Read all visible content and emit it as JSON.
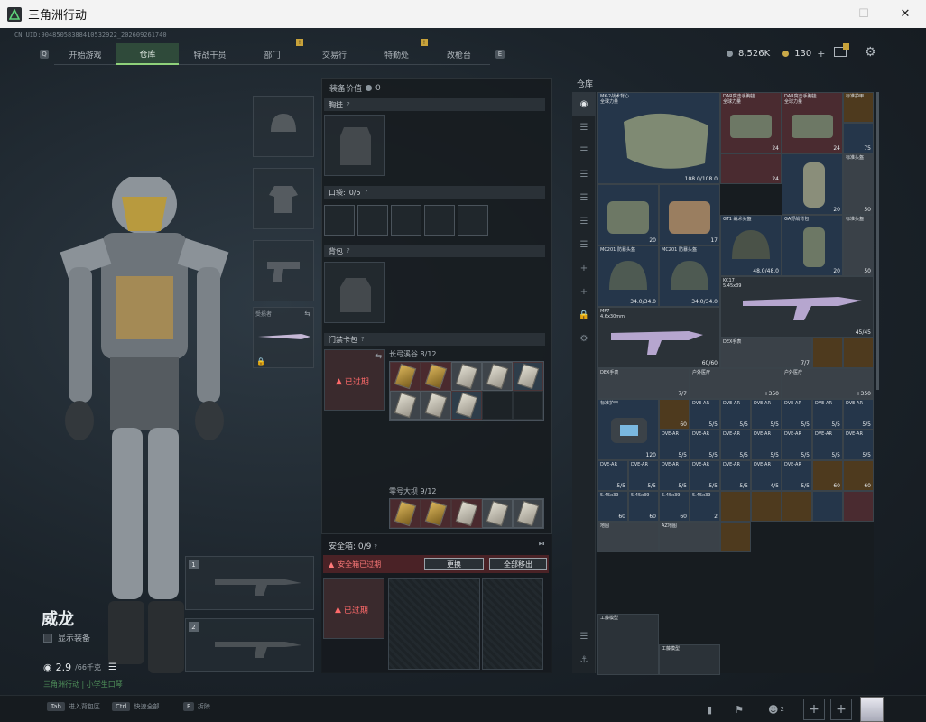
{
  "window": {
    "title": "三角洲行动"
  },
  "uid": "CN UID:9048505838841053292​2_202609261740",
  "nav": {
    "left_key": "Q",
    "right_key": "E",
    "tabs": [
      {
        "label": "开始游戏",
        "active": false,
        "badge": ""
      },
      {
        "label": "仓库",
        "active": true,
        "badge": ""
      },
      {
        "label": "特战干员",
        "active": false,
        "badge": ""
      },
      {
        "label": "部门",
        "active": false,
        "badge": "!"
      },
      {
        "label": "交易行",
        "active": false,
        "badge": ""
      },
      {
        "label": "特勤处",
        "active": false,
        "badge": "!"
      },
      {
        "label": "改枪台",
        "active": false,
        "badge": ""
      }
    ]
  },
  "currency": {
    "silver": "8,526K",
    "gold": "130",
    "plus": "+"
  },
  "operator": {
    "name": "威龙",
    "show_equip": "显示装备",
    "weight": "2.9",
    "weight_max": "/66千克",
    "tip": "三角洲行动 | 小学生口琴"
  },
  "weapon_slot_label": "受损者",
  "slot_numbers": [
    "1",
    "2"
  ],
  "equip": {
    "value_label": "装备价值",
    "value": "0",
    "chest": "胸挂",
    "pockets": "口袋:",
    "pockets_count": "0/5",
    "backpack": "背包",
    "cardcase": "门禁卡包",
    "expired": "已过期",
    "card_sets": [
      {
        "name": "长弓溪谷",
        "count": "8/12"
      },
      {
        "name": "零号大坝",
        "count": "9/12"
      }
    ]
  },
  "safebox": {
    "label": "安全箱:",
    "count": "0/9",
    "warning": "安全箱已过期",
    "btn_replace": "更换",
    "btn_remove_all": "全部移出",
    "expired": "已过期"
  },
  "stash": {
    "title": "仓库",
    "items_row1": [
      {
        "name": "MK-2战术背心\n全球力量",
        "qty": "108.0/108.0"
      },
      {
        "name": "DAR突击手胸挂\n全球力量",
        "qty": "24"
      },
      {
        "name": "DAR突击手胸挂\n全球力量",
        "qty": "24"
      },
      {
        "name": "标准护甲",
        "qty": ""
      }
    ],
    "labels": {
      "mc201a": "MC201 防暴头盔",
      "mc201b": "MC201 防暴头盔",
      "mc201_qty": "34.0/34.0",
      "gt1": "GT1 战术头盔",
      "gt1_qty": "48.0/48.0",
      "ga": "GA野战背包",
      "ga_qty": "20",
      "ga2_qty": "24",
      "std_helmet": "标准头盔",
      "qty50": "50",
      "qty75": "75",
      "qty17": "17",
      "qty20": "20",
      "kc17": "KC17\n5.45x39",
      "kc17_qty": "45/45",
      "mp7": "MP7\n4.6x30mm",
      "mp7_qty": "60/60",
      "bag_qty": "7/7",
      "dex": "DEX手表",
      "pkg1": "户外医疗",
      "pkg1_qty": "+350",
      "pkg2": "户外医疗",
      "pkg2_qty": "+350",
      "fog": "标准护甲",
      "fog_qty": "120",
      "ammo_dve": "DVE-AR",
      "ammo55": "5/5",
      "ammo45": "4/5",
      "ammo_545": "5.45x39",
      "ammo_qty": "60",
      "ammo_qty2": "2",
      "map": "地图",
      "map2": "AZ地图",
      "toy1": "工藤模型",
      "toy2": "工藤模型"
    }
  },
  "bottom": {
    "keys": [
      {
        "key": "Tab",
        "label": "进入背包区"
      },
      {
        "key": "Ctrl",
        "label": "快速全部"
      },
      {
        "key": "F",
        "label": "拆除"
      }
    ],
    "friends": "2"
  }
}
